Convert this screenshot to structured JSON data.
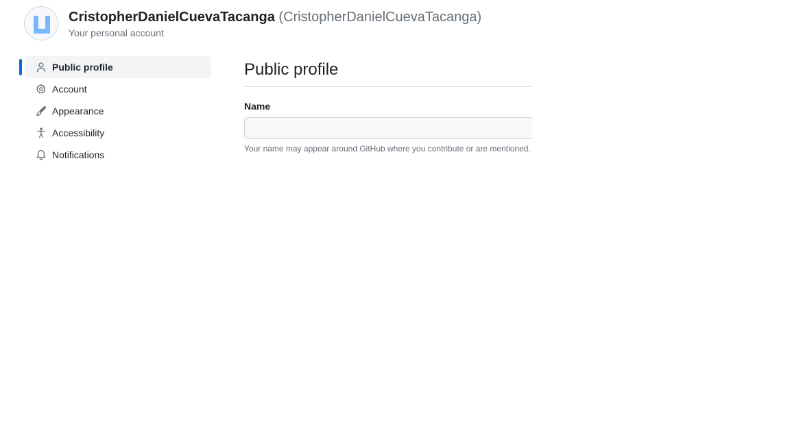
{
  "header": {
    "username": "CristopherDanielCuevaTacanga",
    "login": "(CristopherDanielCuevaTacanga)",
    "subtitle": "Your personal account",
    "avatar_icon": "identicon-avatar"
  },
  "sidebar": {
    "items": [
      {
        "label": "Public profile",
        "icon": "person-icon",
        "active": true
      },
      {
        "label": "Account",
        "icon": "gear-icon",
        "active": false
      },
      {
        "label": "Appearance",
        "icon": "paintbrush-icon",
        "active": false
      },
      {
        "label": "Accessibility",
        "icon": "accessibility-icon",
        "active": false
      },
      {
        "label": "Notifications",
        "icon": "bell-icon",
        "active": false
      }
    ]
  },
  "main": {
    "title": "Public profile",
    "name_field": {
      "label": "Name",
      "value": "",
      "placeholder": "",
      "note": "Your name may appear around GitHub where you contribute or are mentioned."
    }
  },
  "colors": {
    "accent": "#0969da",
    "muted_text": "#656d76",
    "border": "#d0d7de",
    "avatar_blue": "#79b8ff"
  }
}
